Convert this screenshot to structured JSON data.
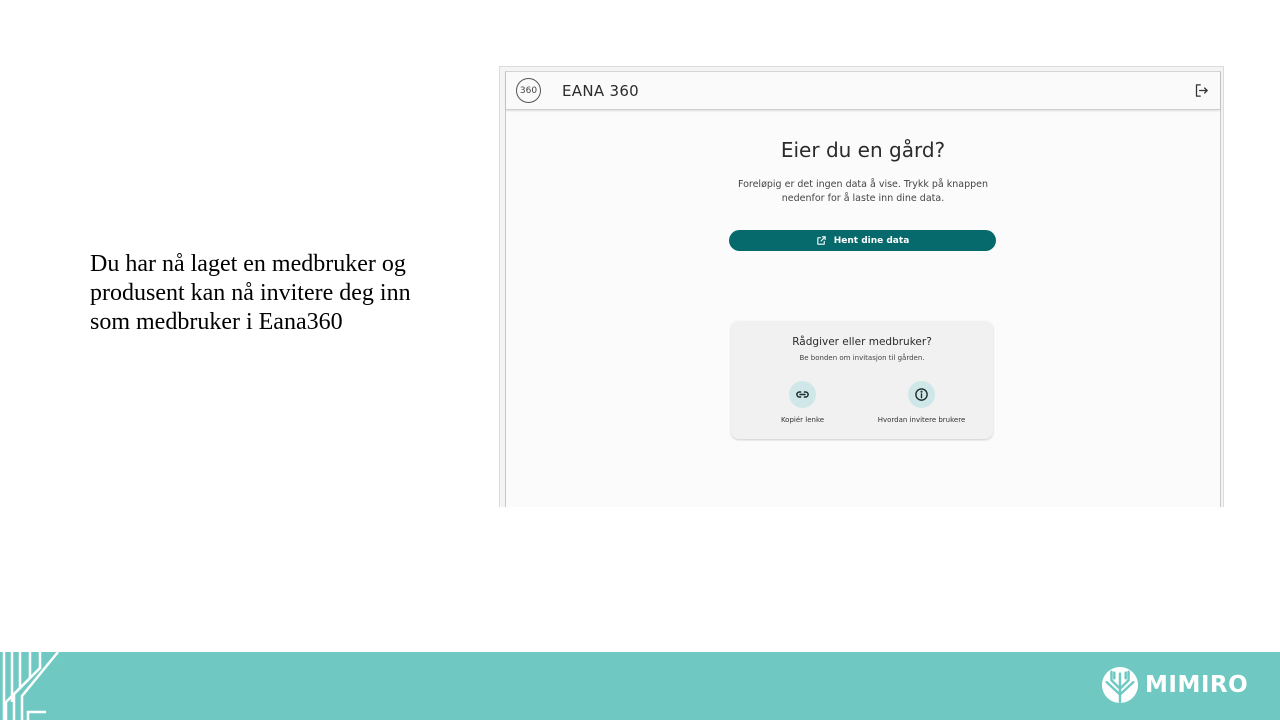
{
  "slide": {
    "caption": "Du har nå laget en medbruker og produsent kan nå invitere deg inn som medbruker i Eana360"
  },
  "app": {
    "logo_text": "360",
    "name": "EANA 360",
    "logout_icon": "logout-icon"
  },
  "main": {
    "heading": "Eier du en gård?",
    "description_line1": "Foreløpig er det ingen data å vise. Trykk på knappen",
    "description_line2": "nedenfor for å laste inn dine data.",
    "cta_label": "Hent dine data",
    "cta_icon": "open-external-icon"
  },
  "card": {
    "title": "Rådgiver eller medbruker?",
    "subtitle": "Be bonden om invitasjon til gården.",
    "actions": [
      {
        "label": "Kopiér lenke",
        "icon": "link-icon"
      },
      {
        "label": "Hvordan invitere brukere",
        "icon": "info-icon"
      }
    ]
  },
  "footer": {
    "brand": "MIMIRO"
  },
  "colors": {
    "primary": "#066a6c",
    "footer": "#6fc9c2",
    "action_circle": "#cfe7e8"
  }
}
